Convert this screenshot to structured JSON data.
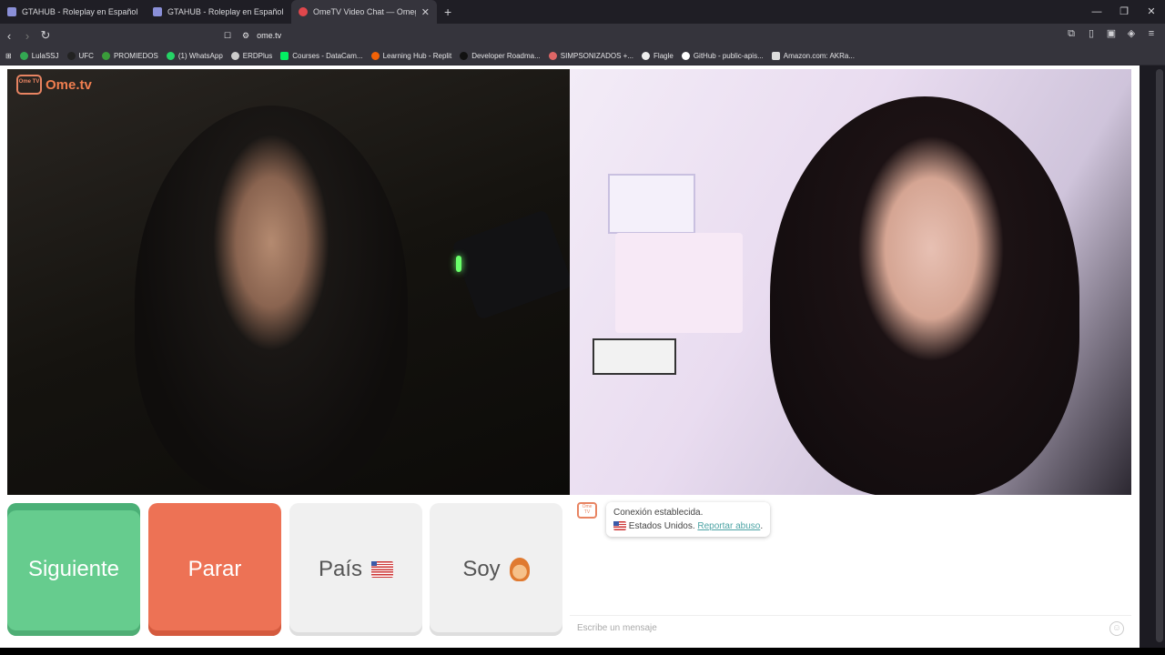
{
  "tabs": [
    {
      "title": "GTAHUB - Roleplay en Español",
      "active": false
    },
    {
      "title": "GTAHUB - Roleplay en Español",
      "active": false
    },
    {
      "title": "OmeTV Video Chat — Omegle",
      "active": true
    }
  ],
  "address": {
    "url": "ome.tv"
  },
  "bookmarks": [
    "LulaSSJ",
    "UFC",
    "PROMIEDOS",
    "(1) WhatsApp",
    "ERDPlus",
    "Courses - DataCam...",
    "Learning Hub - Replit",
    "Developer Roadma...",
    "SIMPSONIZADOS +...",
    "Flagle",
    "GitHub - public-apis...",
    "Amazon.com: AKRa..."
  ],
  "logo": {
    "text": "Ome.tv",
    "badge": "Ome TV"
  },
  "buttons": {
    "next": "Siguiente",
    "stop": "Parar",
    "country": "País",
    "gender": "Soy"
  },
  "chat": {
    "status": "Conexión establecida.",
    "country": "Estados Unidos.",
    "report": "Reportar abuso",
    "placeholder": "Escribe un mensaje"
  },
  "colors": {
    "green": "#66cc8e",
    "red": "#ed7255",
    "accent": "#e88462"
  }
}
